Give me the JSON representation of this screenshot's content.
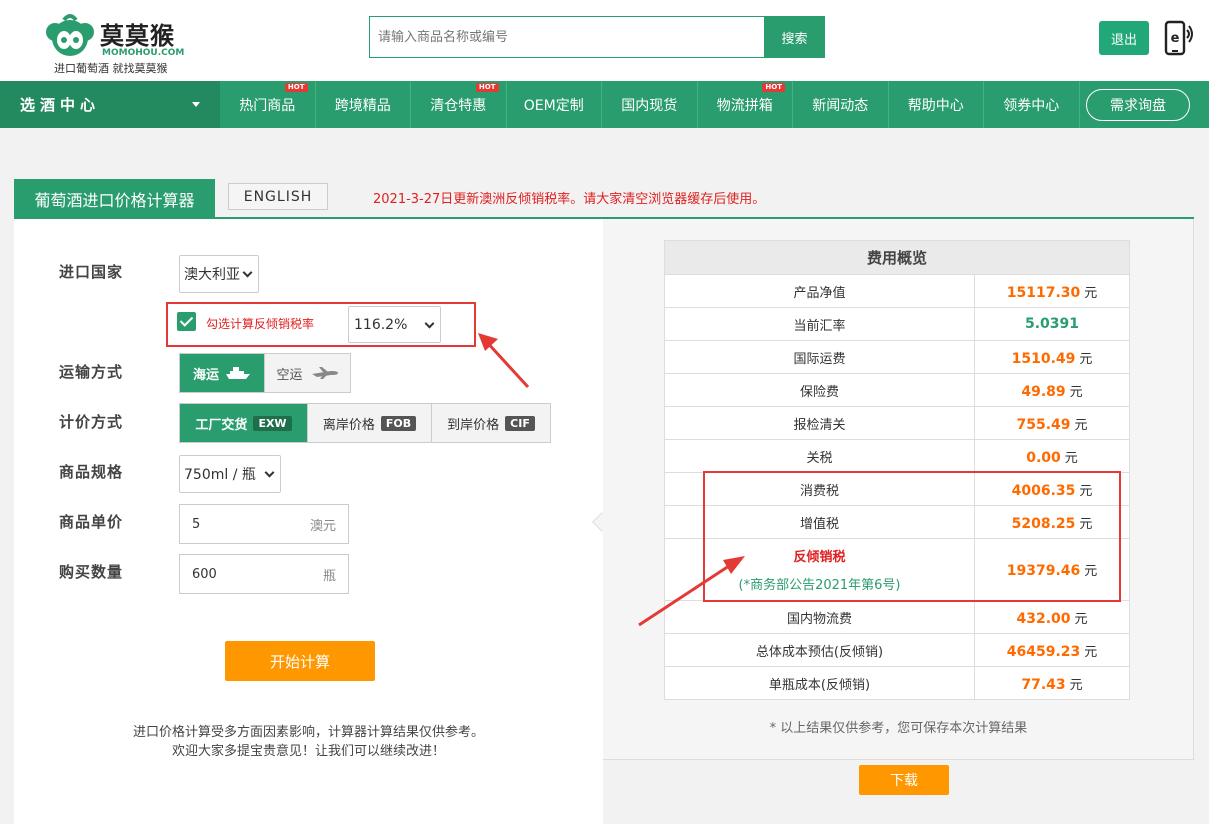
{
  "header": {
    "logo_name": "莫莫猴",
    "logo_en": "MOMOHOU.COM",
    "logo_slogan": "进口葡萄酒 就找莫莫猴",
    "search_placeholder": "请输入商品名称或编号",
    "search_button": "搜索",
    "logout_button": "退出"
  },
  "nav": {
    "category": "选酒中心",
    "items": [
      {
        "label": "热门商品",
        "hot": "HOT"
      },
      {
        "label": "跨境精品",
        "hot": ""
      },
      {
        "label": "清仓特惠",
        "hot": "HOT"
      },
      {
        "label": "OEM定制",
        "hot": ""
      },
      {
        "label": "国内现货",
        "hot": ""
      },
      {
        "label": "物流拼箱",
        "hot": "HOT"
      },
      {
        "label": "新闻动态",
        "hot": ""
      },
      {
        "label": "帮助中心",
        "hot": ""
      },
      {
        "label": "领券中心",
        "hot": ""
      }
    ],
    "inquiry": "需求询盘"
  },
  "tabs": {
    "active": "葡萄酒进口价格计算器",
    "english": "ENGLISH",
    "notice": "2021-3-27日更新澳洲反倾销税率。请大家清空浏览器缓存后使用。"
  },
  "form": {
    "country_label": "进口国家",
    "country_value": "澳大利亚",
    "anti_dumping_checked": true,
    "anti_dumping_label": "勾选计算反倾销税率",
    "anti_dumping_rate": "116.2%",
    "transport_label": "运输方式",
    "transport_sea": "海运",
    "transport_air": "空运",
    "pricing_label": "计价方式",
    "pricing_options": [
      {
        "label": "工厂交货",
        "code": "EXW",
        "active": true
      },
      {
        "label": "离岸价格",
        "code": "FOB",
        "active": false
      },
      {
        "label": "到岸价格",
        "code": "CIF",
        "active": false
      }
    ],
    "spec_label": "商品规格",
    "spec_value": "750ml / 瓶",
    "price_label": "商品单价",
    "price_value": "5",
    "price_unit": "澳元",
    "qty_label": "购买数量",
    "qty_value": "600",
    "qty_unit": "瓶",
    "calc_button": "开始计算",
    "disclaimer_line1": "进口价格计算受多方面因素影响，计算器计算结果仅供参考。",
    "disclaimer_line2": "欢迎大家多提宝贵意见！让我们可以继续改进！"
  },
  "fees": {
    "title": "费用概览",
    "unit": "元",
    "rows": {
      "net_value": {
        "name": "产品净值",
        "value": "15117.30"
      },
      "exchange_rate": {
        "name": "当前汇率",
        "value": "5.0391"
      },
      "intl_freight": {
        "name": "国际运费",
        "value": "1510.49"
      },
      "insurance": {
        "name": "保险费",
        "value": "49.89"
      },
      "customs": {
        "name": "报检清关",
        "value": "755.49"
      },
      "tariff": {
        "name": "关税",
        "value": "0.00"
      },
      "consumption_tax": {
        "name": "消费税",
        "value": "4006.35"
      },
      "vat": {
        "name": "增值税",
        "value": "5208.25"
      },
      "anti_dumping": {
        "name": "反倾销税",
        "note": "(*商务部公告2021年第6号)",
        "value": "19379.46"
      },
      "domestic_logistics": {
        "name": "国内物流费",
        "value": "432.00"
      },
      "total_cost": {
        "name": "总体成本预估(反倾销)",
        "value": "46459.23"
      },
      "unit_cost": {
        "name": "单瓶成本(反倾销)",
        "value": "77.43"
      }
    },
    "note": "* 以上结果仅供参考，您可保存本次计算结果",
    "download_button": "下载"
  },
  "colors": {
    "brand_green": "#2a9d6e",
    "accent_orange": "#ff9800",
    "value_orange": "#ff6a00",
    "alert_red": "#e53935"
  }
}
